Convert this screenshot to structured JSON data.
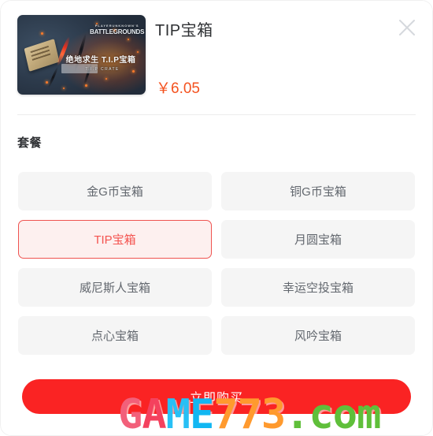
{
  "product": {
    "title": "TIP宝箱",
    "price": "￥6.05",
    "thumbnail": {
      "brand_small": "PLAYERUNKNOWN'S",
      "brand_big": "BATTLEGROUNDS",
      "headline": "绝地求生  T.I.P宝箱",
      "subline": "T.I.P CRATE"
    }
  },
  "header": {
    "close_icon": "close-icon"
  },
  "section": {
    "label": "套餐"
  },
  "options": [
    {
      "label": "金G币宝箱",
      "selected": false
    },
    {
      "label": "铜G币宝箱",
      "selected": false
    },
    {
      "label": "TIP宝箱",
      "selected": true
    },
    {
      "label": "月圆宝箱",
      "selected": false
    },
    {
      "label": "威尼斯人宝箱",
      "selected": false
    },
    {
      "label": "幸运空投宝箱",
      "selected": false
    },
    {
      "label": "点心宝箱",
      "selected": false
    },
    {
      "label": "风吟宝箱",
      "selected": false
    }
  ],
  "buy": {
    "label": "立即购买"
  },
  "watermark": {
    "part_g": "G",
    "part_a": "A",
    "part_m": "M",
    "part_e": "E",
    "part_n": "773",
    "part_d": ".com"
  },
  "colors": {
    "accent_red": "#fa2323",
    "price_orange": "#f4521f",
    "selected_border": "#ef5350",
    "selected_bg": "#fdf0ef",
    "option_bg": "#f5f5f5",
    "option_text": "#62676e",
    "title_text": "#2f3134"
  }
}
